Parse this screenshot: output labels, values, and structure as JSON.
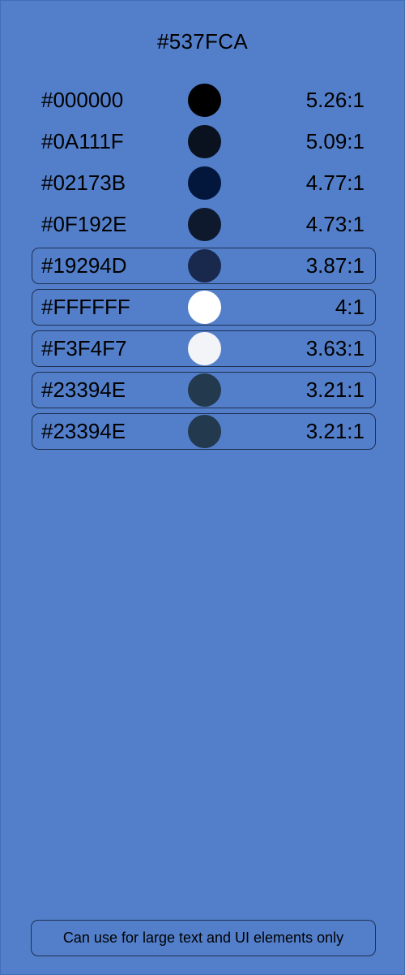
{
  "colors": {
    "background": "#537FCA"
  },
  "header": {
    "title": "#537FCA"
  },
  "rows": [
    {
      "hex": "#000000",
      "ratio": "5.26:1",
      "swatch": "#000000",
      "framed": false
    },
    {
      "hex": "#0A111F",
      "ratio": "5.09:1",
      "swatch": "#0A111F",
      "framed": false
    },
    {
      "hex": "#02173B",
      "ratio": "4.77:1",
      "swatch": "#02173B",
      "framed": false
    },
    {
      "hex": "#0F192E",
      "ratio": "4.73:1",
      "swatch": "#0F192E",
      "framed": false
    },
    {
      "hex": "#19294D",
      "ratio": "3.87:1",
      "swatch": "#19294D",
      "framed": true
    },
    {
      "hex": "#FFFFFF",
      "ratio": "4:1",
      "swatch": "#FFFFFF",
      "framed": true
    },
    {
      "hex": "#F3F4F7",
      "ratio": "3.63:1",
      "swatch": "#F3F4F7",
      "framed": true
    },
    {
      "hex": "#23394E",
      "ratio": "3.21:1",
      "swatch": "#23394E",
      "framed": true
    },
    {
      "hex": "#23394E",
      "ratio": "3.21:1",
      "swatch": "#23394E",
      "framed": true
    }
  ],
  "footer": {
    "note": "Can use for large text and UI elements only"
  }
}
